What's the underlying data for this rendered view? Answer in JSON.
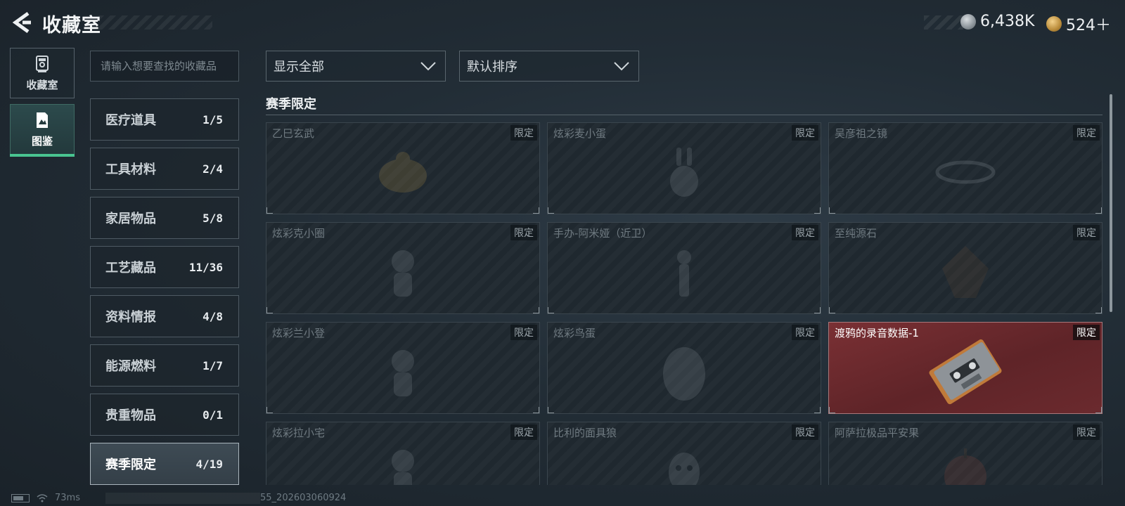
{
  "header": {
    "title": "收藏室",
    "currencies": [
      {
        "icon": "silver-coin-icon",
        "value": "6,438K"
      },
      {
        "icon": "gold-coin-icon",
        "value": "524＋"
      }
    ]
  },
  "nav": [
    {
      "label": "收藏室",
      "icon": "collection-room-icon",
      "selected": false
    },
    {
      "label": "图鉴",
      "icon": "catalog-book-icon",
      "selected": true
    }
  ],
  "search": {
    "placeholder": "请输入想要查找的收藏品",
    "value": ""
  },
  "categories": [
    {
      "name": "医疗道具",
      "count": "1/5"
    },
    {
      "name": "工具材料",
      "count": "2/4"
    },
    {
      "name": "家居物品",
      "count": "5/8"
    },
    {
      "name": "工艺藏品",
      "count": "11/36"
    },
    {
      "name": "资料情报",
      "count": "4/8"
    },
    {
      "name": "能源燃料",
      "count": "1/7"
    },
    {
      "name": "贵重物品",
      "count": "0/1"
    },
    {
      "name": "赛季限定",
      "count": "4/19",
      "selected": true
    }
  ],
  "filters": {
    "display": {
      "label": "显示全部",
      "icon": "chevron-down-icon"
    },
    "sort": {
      "label": "默认排序",
      "icon": "chevron-down-icon"
    }
  },
  "section": {
    "title": "赛季限定",
    "items": [
      {
        "name": "乙巳玄武",
        "badge": "限定",
        "owned": false,
        "icon": "turtle-figure-icon"
      },
      {
        "name": "炫彩麦小蛋",
        "badge": "限定",
        "owned": false,
        "icon": "rabbit-figure-icon"
      },
      {
        "name": "吴彦祖之镜",
        "badge": "限定",
        "owned": false,
        "icon": "mirror-icon"
      },
      {
        "name": "炫彩克小圈",
        "badge": "限定",
        "owned": false,
        "icon": "figurine-icon"
      },
      {
        "name": "手办-阿米娅（近卫）",
        "badge": "限定",
        "owned": false,
        "icon": "figurine-icon"
      },
      {
        "name": "至纯源石",
        "badge": "限定",
        "owned": false,
        "icon": "crystal-icon"
      },
      {
        "name": "炫彩兰小登",
        "badge": "限定",
        "owned": false,
        "icon": "figurine-icon"
      },
      {
        "name": "炫彩鸟蛋",
        "badge": "限定",
        "owned": false,
        "icon": "egg-icon"
      },
      {
        "name": "渡鸦的录音数据-1",
        "badge": "限定",
        "owned": true,
        "icon": "cassette-tape-icon"
      },
      {
        "name": "炫彩拉小宅",
        "badge": "限定",
        "owned": false,
        "icon": "figurine-icon"
      },
      {
        "name": "比利的面具狼",
        "badge": "限定",
        "owned": false,
        "icon": "mask-icon"
      },
      {
        "name": "阿萨拉极品平安果",
        "badge": "限定",
        "owned": false,
        "icon": "apple-icon"
      }
    ]
  },
  "status": {
    "ping": "73ms",
    "build": "55_202603060924"
  }
}
